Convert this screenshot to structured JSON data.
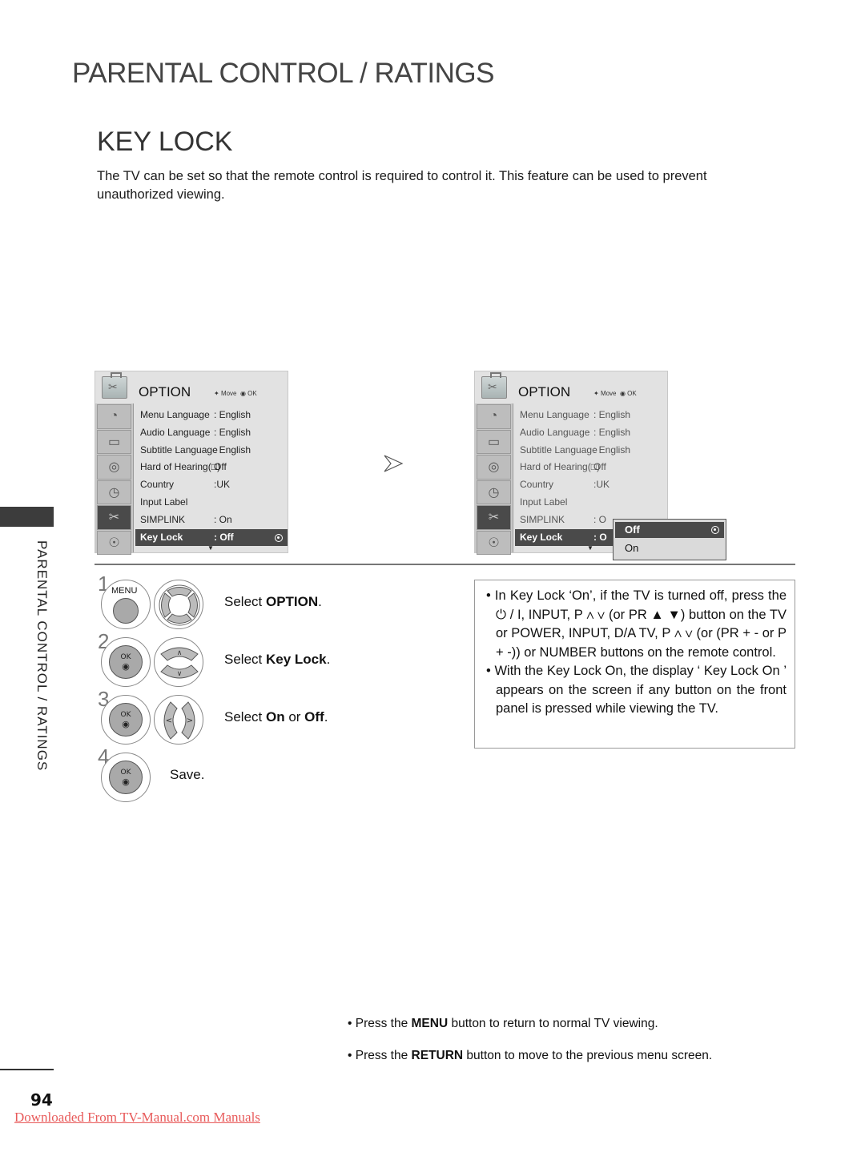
{
  "section_title": "PARENTAL CONTROL / RATINGS",
  "page_heading": "KEY LOCK",
  "intro": "The TV can be set so that the remote control is required to control it. This feature can be used to prevent unauthorized viewing.",
  "side_label": "PARENTAL CONTROL / RATINGS",
  "osd_menu": {
    "title": "OPTION",
    "hint_move": "Move",
    "hint_ok": "OK",
    "sidebar_icons": [
      "satellite-dish-icon",
      "tv-screen-icon",
      "speaker-icon",
      "clock-icon",
      "toolbox-icon",
      "padlock-icon"
    ],
    "rows": [
      {
        "label": "Menu Language",
        "value": ": English"
      },
      {
        "label": "Audio Language",
        "value": ": English"
      },
      {
        "label": "Subtitle Language",
        "value": ": English"
      },
      {
        "label": "Hard of Hearing(□)",
        "value": "Off"
      },
      {
        "label": "Country",
        "value": ":UK"
      },
      {
        "label": "Input Label",
        "value": ""
      },
      {
        "label": "SIMPLINK",
        "value": ": On"
      },
      {
        "label": "Key Lock",
        "value": ": Off"
      }
    ],
    "second_menu_truncated": {
      "simplink_value": ": O",
      "keylock_value": ": O"
    }
  },
  "popup": {
    "options": [
      "Off",
      "On"
    ],
    "selected": "Off"
  },
  "steps": [
    {
      "num": "1",
      "button": "MENU",
      "pre": "Select ",
      "bold": "OPTION",
      "post": ".",
      "bold2": "",
      "post2": ""
    },
    {
      "num": "2",
      "button": "OK",
      "pre": "Select ",
      "bold": "Key Lock",
      "post": ".",
      "bold2": "",
      "post2": ""
    },
    {
      "num": "3",
      "button": "OK",
      "pre": "Select ",
      "bold": "On",
      "post": " or ",
      "bold2": "Off",
      "post2": "."
    },
    {
      "num": "4",
      "button": "OK",
      "pre": "Save.",
      "bold": "",
      "post": "",
      "bold2": "",
      "post2": ""
    }
  ],
  "notes": [
    "• In Key Lock ‘On’, if the TV is turned off, press the ⏻ / I, INPUT, P ∧ ∨  (or PR ▲ ▼) button on the TV or POWER, INPUT, D/A TV, P ∧ ∨ (or (PR + - or P + -)) or NUMBER buttons on the remote control.",
    "• With the Key Lock On, the display ‘ Key Lock On ’ appears on the screen if any button on the front panel is pressed while viewing the TV."
  ],
  "footer_notes": [
    {
      "pre": "• Press the ",
      "bold": "MENU",
      "post": " button to return to normal TV viewing."
    },
    {
      "pre": "• Press the ",
      "bold": "RETURN",
      "post": " button to move to the previous menu screen."
    }
  ],
  "page_number": "94",
  "download_link": "Downloaded From TV-Manual.com Manuals",
  "colors": {
    "highlight": "#4a4a4a",
    "link": "#e85a5a",
    "menu_bg": "#e2e2e2"
  }
}
